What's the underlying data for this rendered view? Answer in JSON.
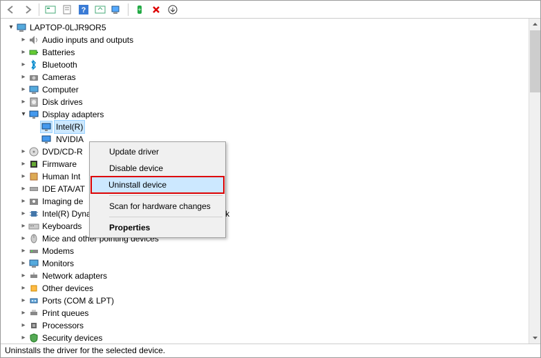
{
  "toolbar_icons": [
    "back",
    "forward",
    "sep",
    "show-hidden",
    "properties",
    "help",
    "update",
    "monitor",
    "sep",
    "add",
    "remove",
    "down"
  ],
  "root": {
    "label": "LAPTOP-0LJR9OR5"
  },
  "categories": [
    {
      "label": "Audio inputs and outputs",
      "icon": "audio",
      "expanded": false
    },
    {
      "label": "Batteries",
      "icon": "battery",
      "expanded": false
    },
    {
      "label": "Bluetooth",
      "icon": "bluetooth",
      "expanded": false
    },
    {
      "label": "Cameras",
      "icon": "camera",
      "expanded": false
    },
    {
      "label": "Computer",
      "icon": "computer",
      "expanded": false
    },
    {
      "label": "Disk drives",
      "icon": "disk",
      "expanded": false
    },
    {
      "label": "Display adapters",
      "icon": "display",
      "expanded": true,
      "children": [
        {
          "label": "Intel(R)",
          "icon": "display",
          "selected": true
        },
        {
          "label": "NVIDIA",
          "icon": "display"
        }
      ]
    },
    {
      "label": "DVD/CD-R",
      "icon": "dvd",
      "expanded": false
    },
    {
      "label": "Firmware",
      "icon": "firmware",
      "expanded": false
    },
    {
      "label": "Human Int",
      "icon": "hid",
      "expanded": false
    },
    {
      "label": "IDE ATA/AT",
      "icon": "ide",
      "expanded": false
    },
    {
      "label": "Imaging de",
      "icon": "imaging",
      "expanded": false
    },
    {
      "label": "Intel(R) Dynamic Platform and Thermal Framework",
      "icon": "chip",
      "expanded": false
    },
    {
      "label": "Keyboards",
      "icon": "keyboard",
      "expanded": false
    },
    {
      "label": "Mice and other pointing devices",
      "icon": "mouse",
      "expanded": false
    },
    {
      "label": "Modems",
      "icon": "modem",
      "expanded": false
    },
    {
      "label": "Monitors",
      "icon": "monitor",
      "expanded": false
    },
    {
      "label": "Network adapters",
      "icon": "network",
      "expanded": false
    },
    {
      "label": "Other devices",
      "icon": "other",
      "expanded": false
    },
    {
      "label": "Ports (COM & LPT)",
      "icon": "port",
      "expanded": false
    },
    {
      "label": "Print queues",
      "icon": "printer",
      "expanded": false
    },
    {
      "label": "Processors",
      "icon": "cpu",
      "expanded": false
    },
    {
      "label": "Security devices",
      "icon": "security",
      "expanded": false
    }
  ],
  "context_menu": {
    "items": [
      {
        "label": "Update driver"
      },
      {
        "label": "Disable device"
      },
      {
        "label": "Uninstall device",
        "highlighted": true
      },
      {
        "sep": true
      },
      {
        "label": "Scan for hardware changes"
      },
      {
        "sep": true
      },
      {
        "label": "Properties",
        "bold": true
      }
    ]
  },
  "status_text": "Uninstalls the driver for the selected device."
}
